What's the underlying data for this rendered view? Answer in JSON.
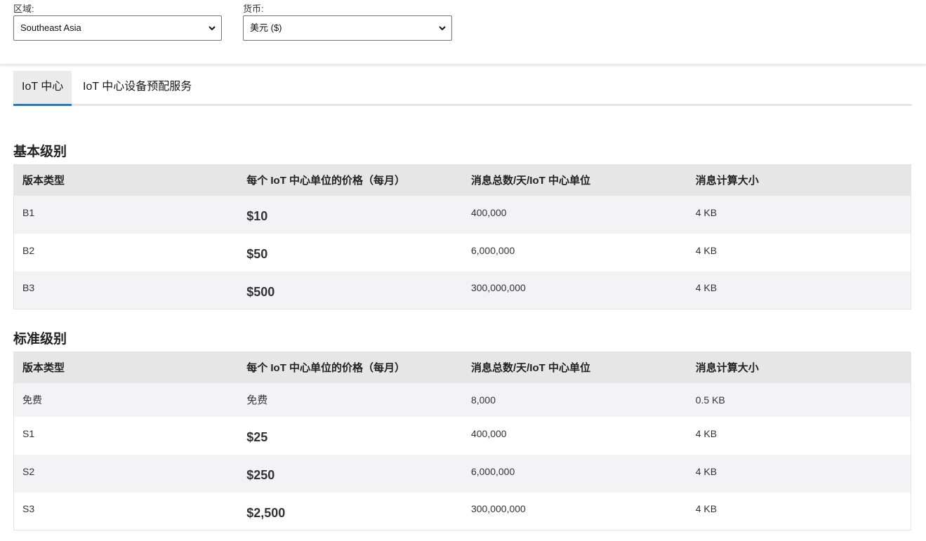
{
  "filters": {
    "region": {
      "label": "区域:",
      "value": "Southeast Asia"
    },
    "currency": {
      "label": "货币:",
      "value": "美元 ($)"
    }
  },
  "tabs": [
    {
      "label": "IoT 中心",
      "active": true
    },
    {
      "label": "IoT 中心设备预配服务",
      "active": false
    }
  ],
  "headers": [
    "版本类型",
    "每个 IoT 中心单位的价格（每月）",
    "消息总数/天/IoT 中心单位",
    "消息计算大小"
  ],
  "basic": {
    "title": "基本级别",
    "rows": [
      {
        "edition": "B1",
        "price": "$10",
        "messages": "400,000",
        "size": "4 KB"
      },
      {
        "edition": "B2",
        "price": "$50",
        "messages": "6,000,000",
        "size": "4 KB"
      },
      {
        "edition": "B3",
        "price": "$500",
        "messages": "300,000,000",
        "size": "4 KB"
      }
    ]
  },
  "standard": {
    "title": "标准级别",
    "rows": [
      {
        "edition": "免费",
        "price": "免费",
        "messages": "8,000",
        "size": "0.5 KB"
      },
      {
        "edition": "S1",
        "price": "$25",
        "messages": "400,000",
        "size": "4 KB"
      },
      {
        "edition": "S2",
        "price": "$250",
        "messages": "6,000,000",
        "size": "4 KB"
      },
      {
        "edition": "S3",
        "price": "$2,500",
        "messages": "300,000,000",
        "size": "4 KB"
      }
    ]
  },
  "icons": {
    "select_chevron": "chevron-down-icon"
  },
  "colors": {
    "tab_active_underline": "#2b78c5",
    "header_bg": "#e6e6e6",
    "row_alt_bg": "#f3f3f5"
  }
}
